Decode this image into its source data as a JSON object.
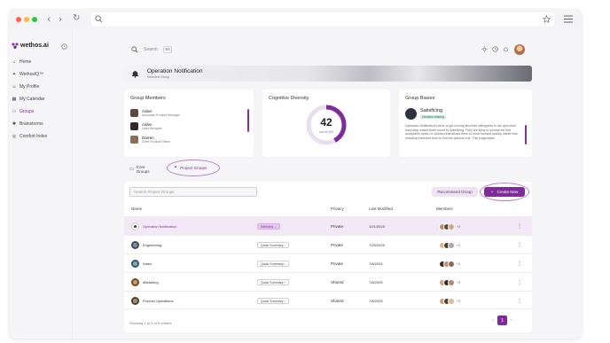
{
  "browser": {
    "back_icon": "chevron-left-icon",
    "forward_icon": "chevron-right-icon",
    "reload_icon": "reload-icon",
    "search_icon": "search-icon",
    "star_icon": "star-icon",
    "menu_icon": "hamburger-icon"
  },
  "sidebar": {
    "logo_text": "wethos.ai",
    "items": [
      {
        "label": "Home",
        "icon": "home-icon"
      },
      {
        "label": "WethosIQ™",
        "icon": "sparkle-icon"
      },
      {
        "label": "My Profile",
        "icon": "user-icon"
      },
      {
        "label": "My Calendar",
        "icon": "calendar-icon"
      },
      {
        "label": "Groups",
        "icon": "groups-icon",
        "active": true
      },
      {
        "label": "Brainstorms",
        "icon": "bulb-icon"
      },
      {
        "label": "Comfort Index",
        "icon": "comfort-icon"
      }
    ]
  },
  "topbar": {
    "search_placeholder": "Search",
    "shortcut": "⌘K"
  },
  "banner": {
    "title": "Operation Notification",
    "subtitle": "Selected Group"
  },
  "members_card": {
    "title": "Group Members",
    "members": [
      {
        "name": "Aiden",
        "role": "Associate Product Manager"
      },
      {
        "name": "Aiden",
        "role": "Lead Designer"
      },
      {
        "name": "Darren",
        "role": "Chief Product Officer"
      }
    ]
  },
  "diversity_card": {
    "title": "Cognitive Diversity",
    "score": "42",
    "score_sub": "out of 100",
    "score_fraction": 0.42
  },
  "biases_card": {
    "title": "Group Biases",
    "bias_name": "Satisficing",
    "bias_tag": "Decision Making",
    "text": "Operation Notification's drive to get moving and their willingness to act upon their early step makes them prone to Satisficing. They are likely to choose the first acceptable option or solution that allows them to move forward quickly, rather than investing extensive time to find the optional one. This pragmatism"
  },
  "tabs": [
    {
      "label": "Core Groups"
    },
    {
      "label": "Project Groups",
      "active": true
    }
  ],
  "toolbar": {
    "search_placeholder": "Search Project Groups",
    "recommend_label": "Recommend Group",
    "create_label": "Create New"
  },
  "table": {
    "headers": {
      "name": "Name",
      "privacy": "Privacy",
      "modified": "Last Modified",
      "members": "Members"
    },
    "rows": [
      {
        "name": "Operation Notification",
        "tag": "Selected",
        "privacy": "Private",
        "modified": "10/1/2025",
        "more": "+2",
        "selected": true
      },
      {
        "name": "Engineering",
        "tag": "Quick Summary",
        "privacy": "Private",
        "modified": "7/25/2025",
        "more": "+1"
      },
      {
        "name": "Sales",
        "tag": "Quick Summary",
        "privacy": "Private",
        "modified": "7/8/2025",
        "more": "+2"
      },
      {
        "name": "Marketing",
        "tag": "Quick Summary",
        "privacy": "Shared",
        "modified": "7/8/2025",
        "more": "+3"
      },
      {
        "name": "Product Operations",
        "tag": "Quick Summary",
        "privacy": "Shared",
        "modified": "7/8/2025",
        "more": "+3"
      }
    ],
    "footer": "Showing 1 to 5 of 5 entries",
    "page": "1"
  },
  "colors": {
    "accent": "#7f2b99",
    "accent_light": "#e6c7ee"
  }
}
